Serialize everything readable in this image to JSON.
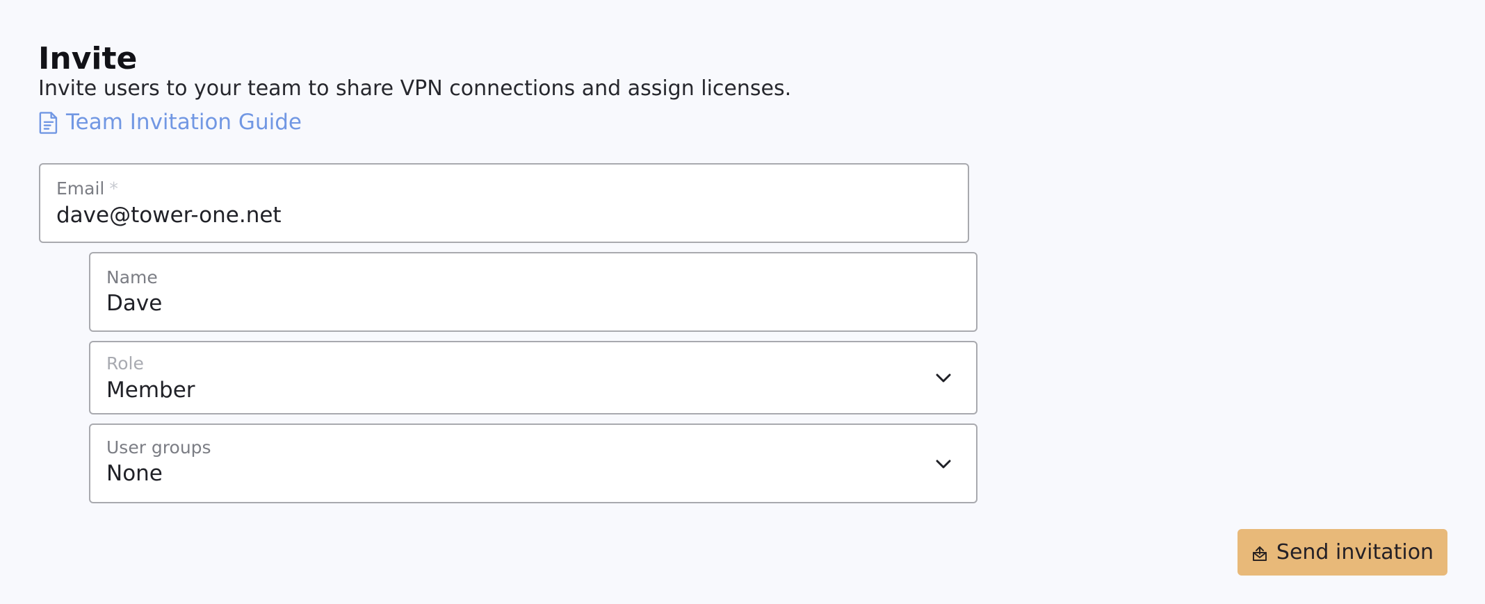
{
  "header": {
    "title": "Invite",
    "description": "Invite users to your team to share VPN connections and assign licenses.",
    "guide_link_label": "Team Invitation Guide",
    "guide_icon": "document-icon"
  },
  "form": {
    "email": {
      "label": "Email",
      "required_marker": "*",
      "value": "dave@tower-one.net"
    },
    "name": {
      "label": "Name",
      "value": "Dave"
    },
    "role": {
      "label": "Role",
      "selected": "Member",
      "icon": "chevron-down-icon"
    },
    "user_groups": {
      "label": "User groups",
      "selected": "None",
      "icon": "chevron-down-icon"
    }
  },
  "actions": {
    "send_label": "Send invitation",
    "send_icon": "mail-send-icon"
  },
  "colors": {
    "accent_link": "#7197e3",
    "primary_button": "#e8b979",
    "background": "#f8f9fd"
  }
}
